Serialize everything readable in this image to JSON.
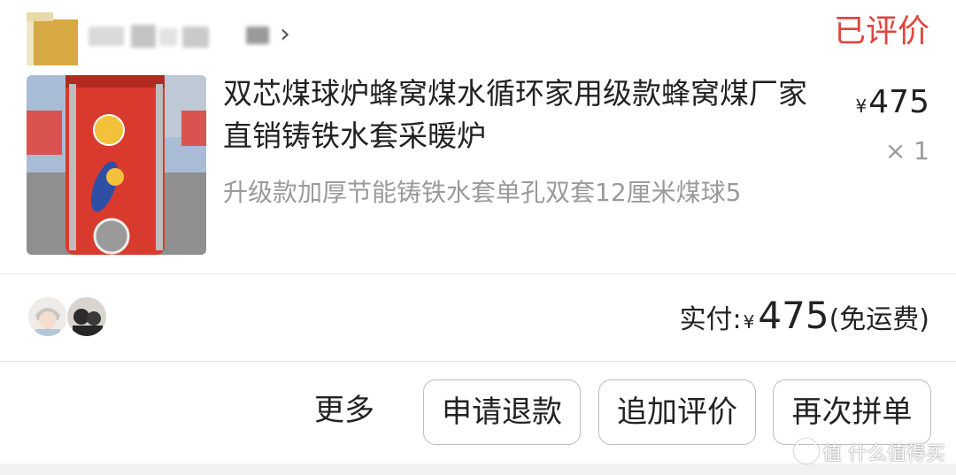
{
  "order": {
    "status": "已评价",
    "product": {
      "title": "双芯煤球炉蜂窝煤水循环家用级款蜂窝煤厂家直销铸铁水套采暖炉",
      "spec": "升级款加厚节能铸铁水套单孔双套12厘米煤球5",
      "price_symbol": "¥",
      "price": "475",
      "quantity": "× 1"
    },
    "payment": {
      "label": "实付:",
      "symbol": "¥",
      "amount": "475",
      "shipping": "(免运费)"
    },
    "actions": {
      "more": "更多",
      "refund": "申请退款",
      "add_review": "追加评价",
      "rebuy": "再次拼单"
    }
  },
  "watermark": "值 什么值得买",
  "colors": {
    "status": "#e0453d",
    "shop_logo": "#d6a942",
    "stove_red": "#d93a2e"
  }
}
